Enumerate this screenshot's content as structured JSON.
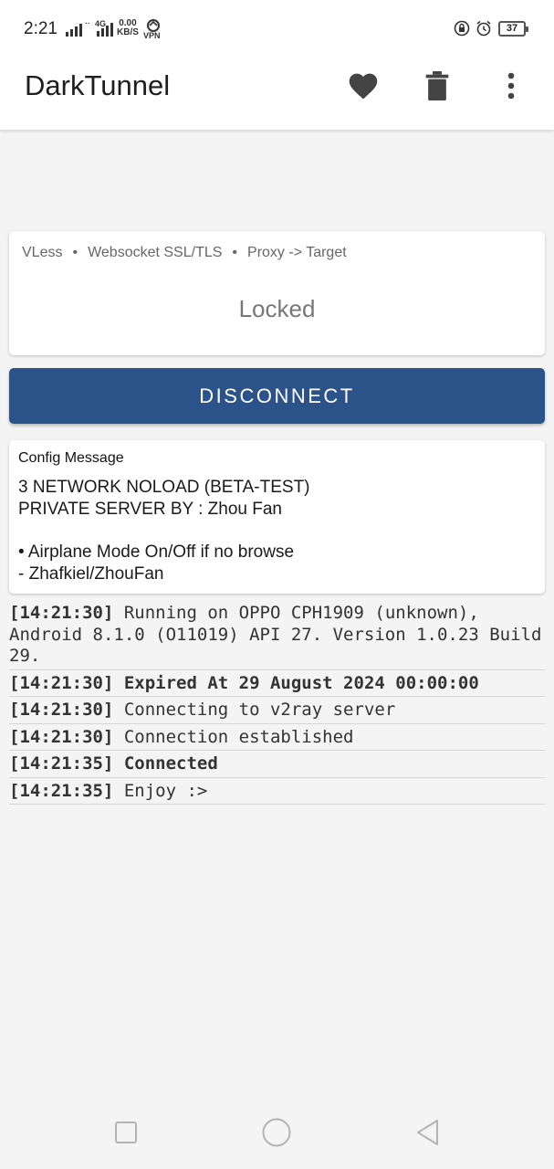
{
  "status_bar": {
    "time": "2:21",
    "network_label": "4G",
    "speed_value": "0.00",
    "speed_unit": "KB/S",
    "vpn_label": "VPN",
    "battery": "37"
  },
  "app_bar": {
    "title": "DarkTunnel",
    "icons": [
      "heart-icon",
      "trash-icon",
      "more-vert-icon"
    ]
  },
  "tunnel": {
    "tags": [
      "VLess",
      "Websocket SSL/TLS",
      "Proxy -> Target"
    ],
    "separator": "•",
    "status": "Locked"
  },
  "connect_button": {
    "label": "DISCONNECT"
  },
  "config_message": {
    "title": "Config Message",
    "lines": [
      "3 NETWORK NOLOAD (BETA-TEST)",
      "PRIVATE SERVER BY : Zhou Fan",
      "• Airplane Mode On/Off if no browse",
      "- Zhafkiel/ZhouFan"
    ]
  },
  "log": [
    {
      "time": "[14:21:30]",
      "message": "Running on OPPO CPH1909 (unknown), Android 8.1.0 (O11019) API 27. Version 1.0.23 Build 29.",
      "bold": false
    },
    {
      "time": "[14:21:30]",
      "message": "Expired At 29 August 2024 00:00:00",
      "bold": true
    },
    {
      "time": "[14:21:30]",
      "message": "Connecting to v2ray server",
      "bold": false
    },
    {
      "time": "[14:21:30]",
      "message": "Connection established",
      "bold": false
    },
    {
      "time": "[14:21:35]",
      "message": "Connected",
      "bold": true
    },
    {
      "time": "[14:21:35]",
      "message": "Enjoy :>",
      "bold": false
    }
  ],
  "nav_bar": {
    "icons": [
      "recent-apps-icon",
      "home-icon",
      "back-icon"
    ]
  },
  "colors": {
    "accent": "#2b5289",
    "background": "#f4f4f4",
    "card": "#ffffff"
  }
}
